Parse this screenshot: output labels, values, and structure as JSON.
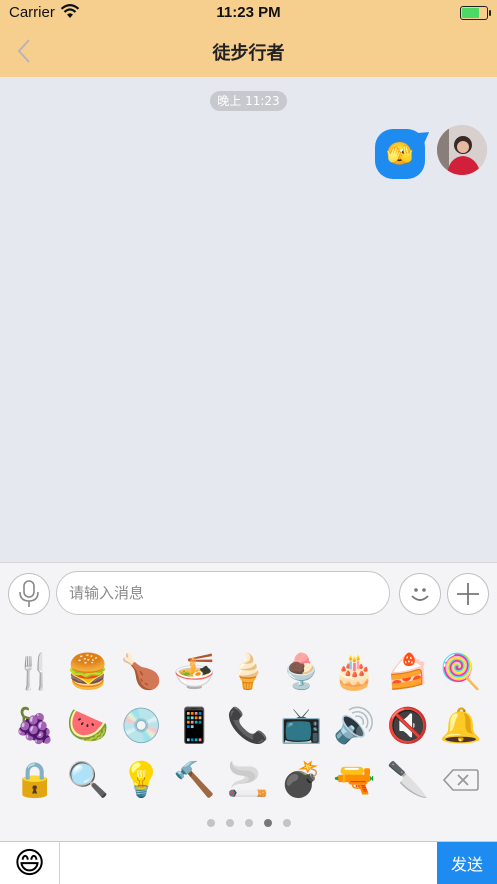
{
  "status_bar": {
    "carrier": "Carrier",
    "time": "11:23 PM",
    "battery_level": 0.75
  },
  "nav": {
    "title": "徒步行者",
    "back_icon": "chevron-left-icon"
  },
  "chat": {
    "time_label": "晚上 11:23",
    "messages": [
      {
        "from": "self",
        "content": "🫣"
      }
    ]
  },
  "input_bar": {
    "placeholder": "请输入消息",
    "voice_icon": "microphone-icon",
    "emoji_icon": "smiley-icon",
    "more_icon": "plus-icon"
  },
  "emoji_panel": {
    "emojis": [
      "🍴",
      "🍔",
      "🍗",
      "🍜",
      "🍦",
      "🍨",
      "🎂",
      "🍰",
      "🍭",
      "🍇",
      "🍉",
      "💿",
      "📱",
      "📞",
      "📺",
      "🔊",
      "🔇",
      "🔔",
      "🔒",
      "🔍",
      "💡",
      "🔨",
      "🚬",
      "💣",
      "🔫",
      "🔪"
    ],
    "delete_icon": "backspace-icon",
    "pages": 5,
    "active_page": 4
  },
  "bottom_bar": {
    "emoji": "😄",
    "send_label": "发送"
  },
  "colors": {
    "header": "#f6cf8f",
    "accent": "#1d8bf0",
    "chat_bg": "#e6e8ef"
  }
}
